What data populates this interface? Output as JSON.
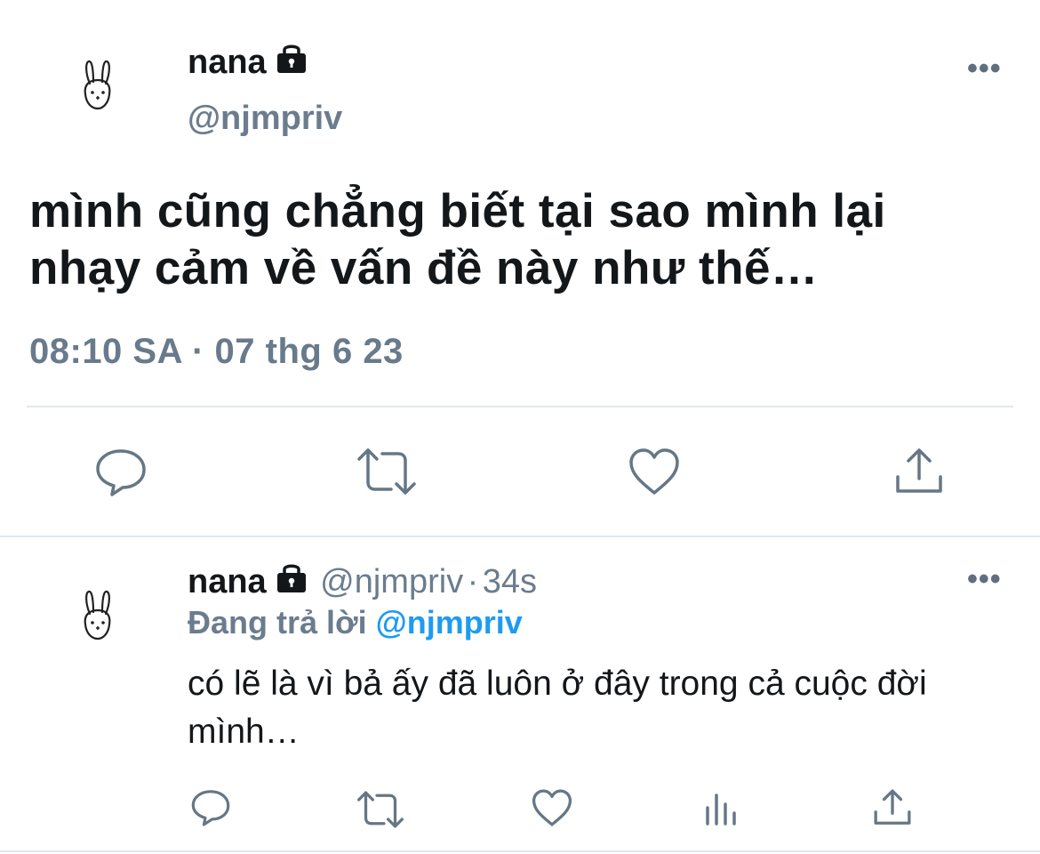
{
  "main_tweet": {
    "author_name": "nana",
    "handle": "@njmpriv",
    "text": "mình cũng chẳng biết tại sao mình lại nhạy cảm về vấn đề này như thế…",
    "timestamp": "08:10 SA · 07 thg 6 23",
    "more": "•••",
    "icons": [
      "avatar-bunny-icon",
      "lock-icon",
      "reply-icon",
      "retweet-icon",
      "like-icon",
      "share-icon"
    ]
  },
  "reply_tweet": {
    "author_name": "nana",
    "handle": "@njmpriv",
    "time_ago": "34s",
    "separator": "·",
    "replying_prefix": "Đang trả lời",
    "replying_to": "@njmpriv",
    "text": "có lẽ là vì bả ấy đã luôn ở đây trong cả cuộc đời mình…",
    "more": "•••",
    "icons": [
      "avatar-bunny-icon",
      "lock-icon",
      "reply-icon",
      "retweet-icon",
      "like-icon",
      "analytics-icon",
      "share-icon"
    ]
  },
  "colors": {
    "text": "#14171a",
    "secondary": "#6b7c8e",
    "accent": "#1d9bf0",
    "divider": "#e2e8ec",
    "icon": "#657786"
  }
}
